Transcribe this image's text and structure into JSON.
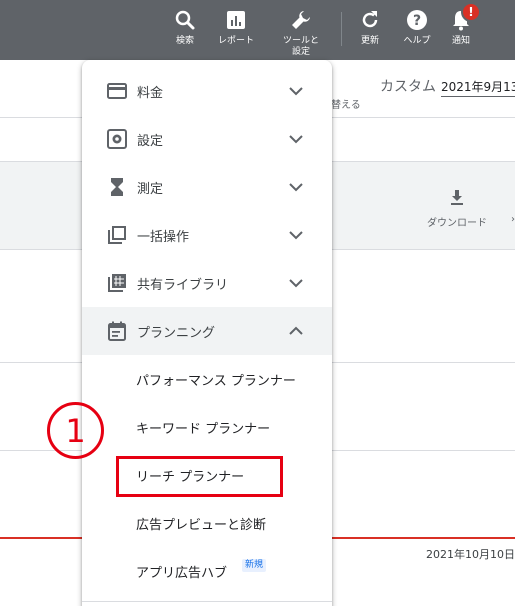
{
  "topbar": {
    "items": [
      {
        "label": "検索",
        "icon": "search-icon"
      },
      {
        "label": "レポート",
        "icon": "reports-icon"
      },
      {
        "label": "ツールと\n設定",
        "icon": "wrench-icon"
      },
      {
        "label": "更新",
        "icon": "refresh-icon"
      },
      {
        "label": "ヘルプ",
        "icon": "help-icon"
      },
      {
        "label": "通知",
        "icon": "bell-icon"
      }
    ],
    "notification_badge": "!",
    "colors": {
      "bar": "#5f6368",
      "badge": "#d93025"
    }
  },
  "page": {
    "custom_label": "カスタム",
    "date_range": "2021年9月13",
    "switch_text": "替える",
    "download_label": "ダウンロード",
    "date_end": "2021年10月10日"
  },
  "menu": {
    "sections": [
      {
        "label": "料金",
        "icon": "billing-icon",
        "expanded": false
      },
      {
        "label": "設定",
        "icon": "settings-icon",
        "expanded": false
      },
      {
        "label": "測定",
        "icon": "hourglass-icon",
        "expanded": false
      },
      {
        "label": "一括操作",
        "icon": "bulk-actions-icon",
        "expanded": false
      },
      {
        "label": "共有ライブラリ",
        "icon": "shared-library-icon",
        "expanded": false
      },
      {
        "label": "プランニング",
        "icon": "planning-icon",
        "expanded": true
      }
    ],
    "planning_items": [
      {
        "label": "パフォーマンス プランナー"
      },
      {
        "label": "キーワード プランナー"
      },
      {
        "label": "リーチ プランナー"
      },
      {
        "label": "広告プレビューと診断"
      },
      {
        "label": "アプリ広告ハブ",
        "badge": "新規"
      }
    ]
  },
  "annotation": {
    "number": "1",
    "color": "#e60012"
  }
}
